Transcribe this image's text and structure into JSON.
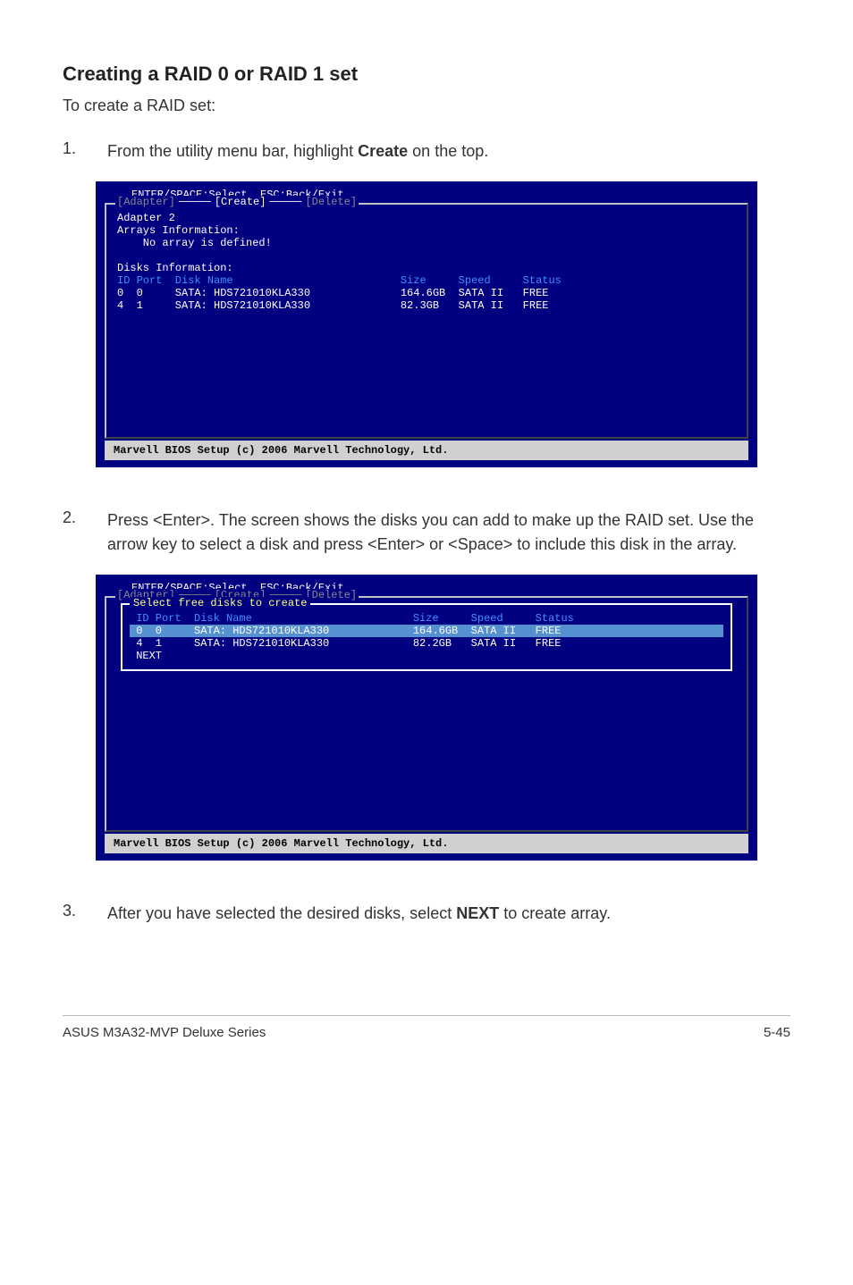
{
  "heading": "Creating a RAID 0 or RAID 1 set",
  "intro": "To create a RAID set:",
  "steps": {
    "1": {
      "num": "1.",
      "prefix": "From the utility menu bar, highlight ",
      "bold": "Create",
      "suffix": " on the top."
    },
    "2": {
      "num": "2.",
      "text": "Press <Enter>. The screen shows the disks you can add to make up the RAID set. Use the arrow key to select a disk and press <Enter> or <Space> to include this disk in the array."
    },
    "3": {
      "num": "3.",
      "prefix": "After you have selected the desired disks, select ",
      "bold": "NEXT",
      "suffix": " to create array."
    }
  },
  "bios1": {
    "header": "ENTER/SPACE:Select, ESC:Back/Exit",
    "tabs": {
      "adapter": "[Adapter]",
      "create": "[Create]",
      "delete": "[Delete]"
    },
    "adapter_line": "Adapter 2",
    "arrays_info": "Arrays Information:",
    "no_array": "    No array is defined!",
    "disks_info": "Disks Information:",
    "col_header": "ID Port  Disk Name                          Size     Speed     Status",
    "row1": "0  0     SATA: HDS721010KLA330              164.6GB  SATA II   FREE",
    "row2": "4  1     SATA: HDS721010KLA330              82.3GB   SATA II   FREE",
    "footer": "Marvell BIOS Setup (c) 2006 Marvell Technology, Ltd."
  },
  "bios2": {
    "header": "ENTER/SPACE:Select, ESC:Back/Exit",
    "tabs": {
      "adapter": "[Adapter]",
      "create": "[Create]",
      "delete": "[Delete]"
    },
    "select_title": "Select free disks to create ",
    "col_header": " ID Port  Disk Name                         Size     Speed     Status",
    "row1": " 0  0     SATA: HDS721010KLA330             164.6GB  SATA II   FREE  ",
    "row2": " 4  1     SATA: HDS721010KLA330             82.2GB   SATA II   FREE",
    "next": " NEXT",
    "footer": "Marvell BIOS Setup (c) 2006 Marvell Technology, Ltd."
  },
  "footer": {
    "left": "ASUS M3A32-MVP Deluxe Series",
    "right": "5-45"
  }
}
